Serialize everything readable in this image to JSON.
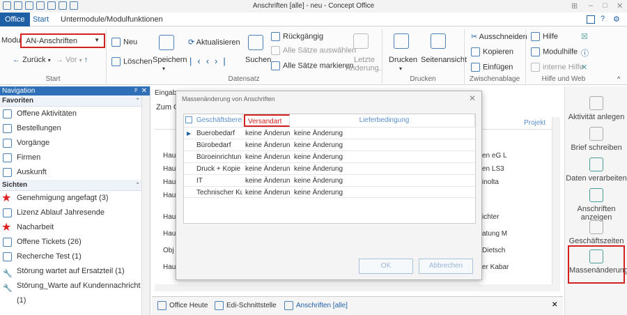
{
  "window": {
    "title": "Anschriften [alle] - neu - Concept Office"
  },
  "tabs": {
    "office": "Office",
    "start": "Start",
    "unter": "Untermodule/Modulfunktionen"
  },
  "ribbon": {
    "modul_label": "Modul",
    "modul_value": "AN-Anschriften",
    "zurueck": "Zurück",
    "vor": "Vor",
    "neu": "Neu",
    "loeschen": "Löschen",
    "speichern": "Speichern",
    "aktualisieren": "Aktualisieren",
    "suchen": "Suchen",
    "rueckgaengig": "Rückgängig",
    "alle_saetze_auswaehlen": "Alle Sätze auswählen",
    "alle_saetze_markieren": "Alle Sätze markieren",
    "letzte_aenderung_1": "Letzte",
    "letzte_aenderung_2": "Änderung..",
    "drucken": "Drucken",
    "seitenansicht": "Seitenansicht",
    "ausschneiden": "Ausschneiden",
    "kopieren": "Kopieren",
    "einfuegen": "Einfügen",
    "hilfe": "Hilfe",
    "modulhilfe": "Modulhilfe",
    "interne_hilfe": "interne Hilfe",
    "groups": {
      "start": "Start",
      "datensatz": "Datensatz",
      "drucken": "Drucken",
      "zwischenablage": "Zwischenablage",
      "hilfe_web": "Hilfe und Web"
    }
  },
  "navigation": {
    "title": "Navigation",
    "favoriten_label": "Favoriten",
    "favoriten": [
      "Offene Aktivitäten",
      "Bestellungen",
      "Vorgänge",
      "Firmen",
      "Auskunft"
    ],
    "sichten_label": "Sichten",
    "sichten": [
      "Genehmigung angefagt (3)",
      "Lizenz Ablauf Jahresende",
      "Nacharbeit",
      "Offene Tickets (26)",
      "Recherche Test (1)",
      "Störung wartet auf Ersatzteil (1)",
      "Störung_Warte auf Kundennachricht (1)"
    ]
  },
  "background_grid": {
    "tab": "Eingab",
    "group": "Zum G",
    "rows": [
      "Hau",
      "Hau",
      "Hau",
      "Hau",
      "Hau",
      "Hau",
      "Obj",
      "Hau"
    ],
    "right_col_header": "Projekt",
    "right_vals": [
      "en eG L",
      "en LS3",
      "inolta",
      "",
      "ichter",
      "atung M",
      "Dietsch",
      "er Kabar"
    ]
  },
  "dialog": {
    "title": "Massenänderung von Anschriften",
    "columns": [
      "Geschäftsberei",
      "Versandart",
      "Lieferbedingung"
    ],
    "rows": [
      [
        "Buerobedarf",
        "keine Änderun",
        "keine Änderung"
      ],
      [
        "Bürobedarf",
        "keine Änderun",
        "keine Änderung"
      ],
      [
        "Büroeinrichtun",
        "keine Änderun",
        "keine Änderung"
      ],
      [
        "Druck + Kopie",
        "keine Änderun",
        "keine Änderung"
      ],
      [
        "IT",
        "keine Änderun",
        "keine Änderung"
      ],
      [
        "Technischer Ku",
        "keine Änderun",
        "keine Änderung"
      ]
    ],
    "ok": "OK",
    "abbrechen": "Abbrechen"
  },
  "right_actions": [
    "Aktivität anlegen",
    "Brief schreiben",
    "Daten verarbeiten",
    "Anschriften anzeigen",
    "Geschäftszeiten",
    "Massenänderung"
  ],
  "bottom_tabs": [
    "Office Heute",
    "Edi-Schnittstelle",
    "Anschriften [alle]"
  ]
}
